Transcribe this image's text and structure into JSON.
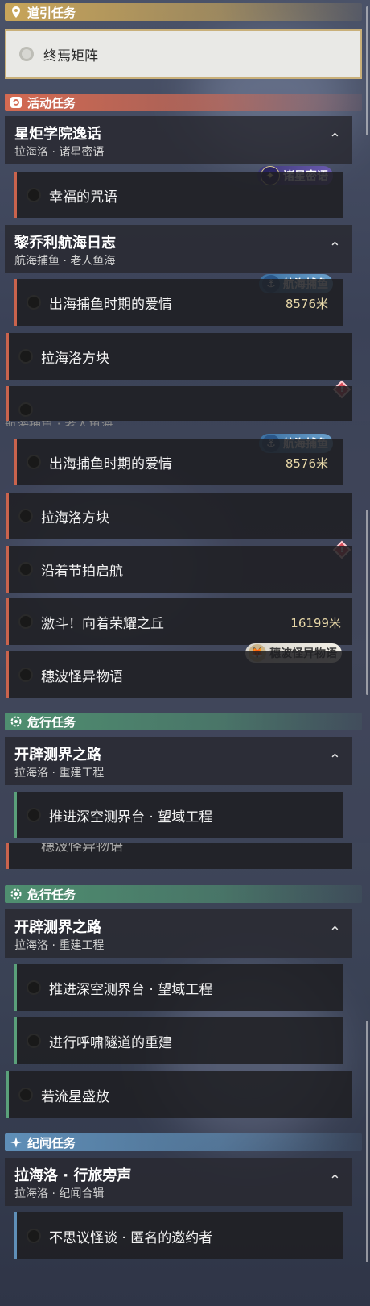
{
  "categories": {
    "guide": "道引任务",
    "event": "活动任务",
    "danger": "危行任务",
    "chronicle": "纪闻任务"
  },
  "selected_quest": "终焉矩阵",
  "groups": {
    "xingju": {
      "title": "星炬学院逸话",
      "subtitle": "拉海洛 · 诸星密语"
    },
    "liqiaoli": {
      "title": "黎乔利航海日志",
      "subtitle": "航海捕鱼 · 老人鱼海"
    },
    "kaipi": {
      "title": "开辟测界之路",
      "subtitle": "拉海洛 · 重建工程"
    },
    "lahailuo": {
      "title": "拉海洛 · 行旅旁声",
      "subtitle": "拉海洛 · 纪闻合辑"
    }
  },
  "quests": {
    "xingfu": "幸福的咒语",
    "chuhai": "出海捕鱼时期的爱情",
    "chuhai_dist": "8576米",
    "fangkuai": "拉海洛方块",
    "yanzhe": "沿着节拍启航",
    "jidou": "激斗！向着荣耀之丘",
    "jidou_dist": "16199米",
    "suibo": "穗波怪异物语",
    "tuijin": "推进深空测界台 · 望域工程",
    "huxiao": "进行呼啸隧道的重建",
    "liuxing": "若流星盛放",
    "busiyi": "不思议怪谈 · 匿名的邀约者"
  },
  "badges": {
    "zhuxing": "诸星密语",
    "hanghai": "航海捕鱼",
    "suibo": "穗波怪异物语"
  },
  "icons": {
    "guide": "pin-icon",
    "event": "refresh-icon",
    "danger": "gear-icon",
    "chronicle": "sparkle-icon",
    "collapse": "chevron-up-icon",
    "warning": "warning-diamond-icon"
  },
  "colors": {
    "guide": "#c8a55a",
    "event": "#d46a52",
    "danger": "#4f8f70",
    "chronicle": "#5f8fb8",
    "distance": "#e8d8a8"
  }
}
